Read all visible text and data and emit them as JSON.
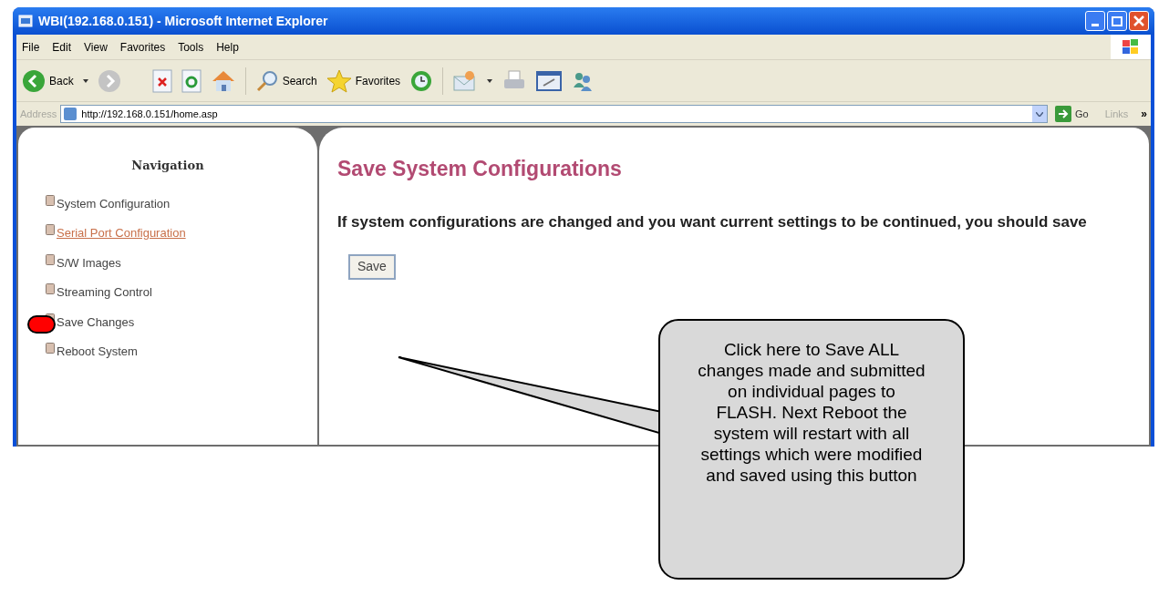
{
  "window": {
    "title": "WBI(192.168.0.151) - Microsoft Internet Explorer"
  },
  "menu": [
    "File",
    "Edit",
    "View",
    "Favorites",
    "Tools",
    "Help"
  ],
  "toolbar": {
    "back": "Back",
    "search": "Search",
    "favorites": "Favorites"
  },
  "address_bar": {
    "label": "Address",
    "url": "http://192.168.0.151/home.asp",
    "go": "Go",
    "links": "Links",
    "more": "»"
  },
  "navigation": {
    "title": "Navigation",
    "items": [
      {
        "label": "System Configuration",
        "hovered": false,
        "marked": false
      },
      {
        "label": "Serial Port Configuration",
        "hovered": true,
        "marked": false
      },
      {
        "label": "S/W Images",
        "hovered": false,
        "marked": false
      },
      {
        "label": "Streaming Control",
        "hovered": false,
        "marked": false
      },
      {
        "label": "Save Changes",
        "hovered": false,
        "marked": true
      },
      {
        "label": "Reboot System",
        "hovered": false,
        "marked": false
      }
    ]
  },
  "content": {
    "title": "Save System Configurations",
    "text": "If system configurations are changed and you want current settings to be continued, you should save",
    "button": "Save"
  },
  "callout": {
    "text": "Click here to Save ALL changes made and submitted on individual pages to FLASH. Next Reboot the system will restart with all settings which were modified and saved using this button"
  }
}
